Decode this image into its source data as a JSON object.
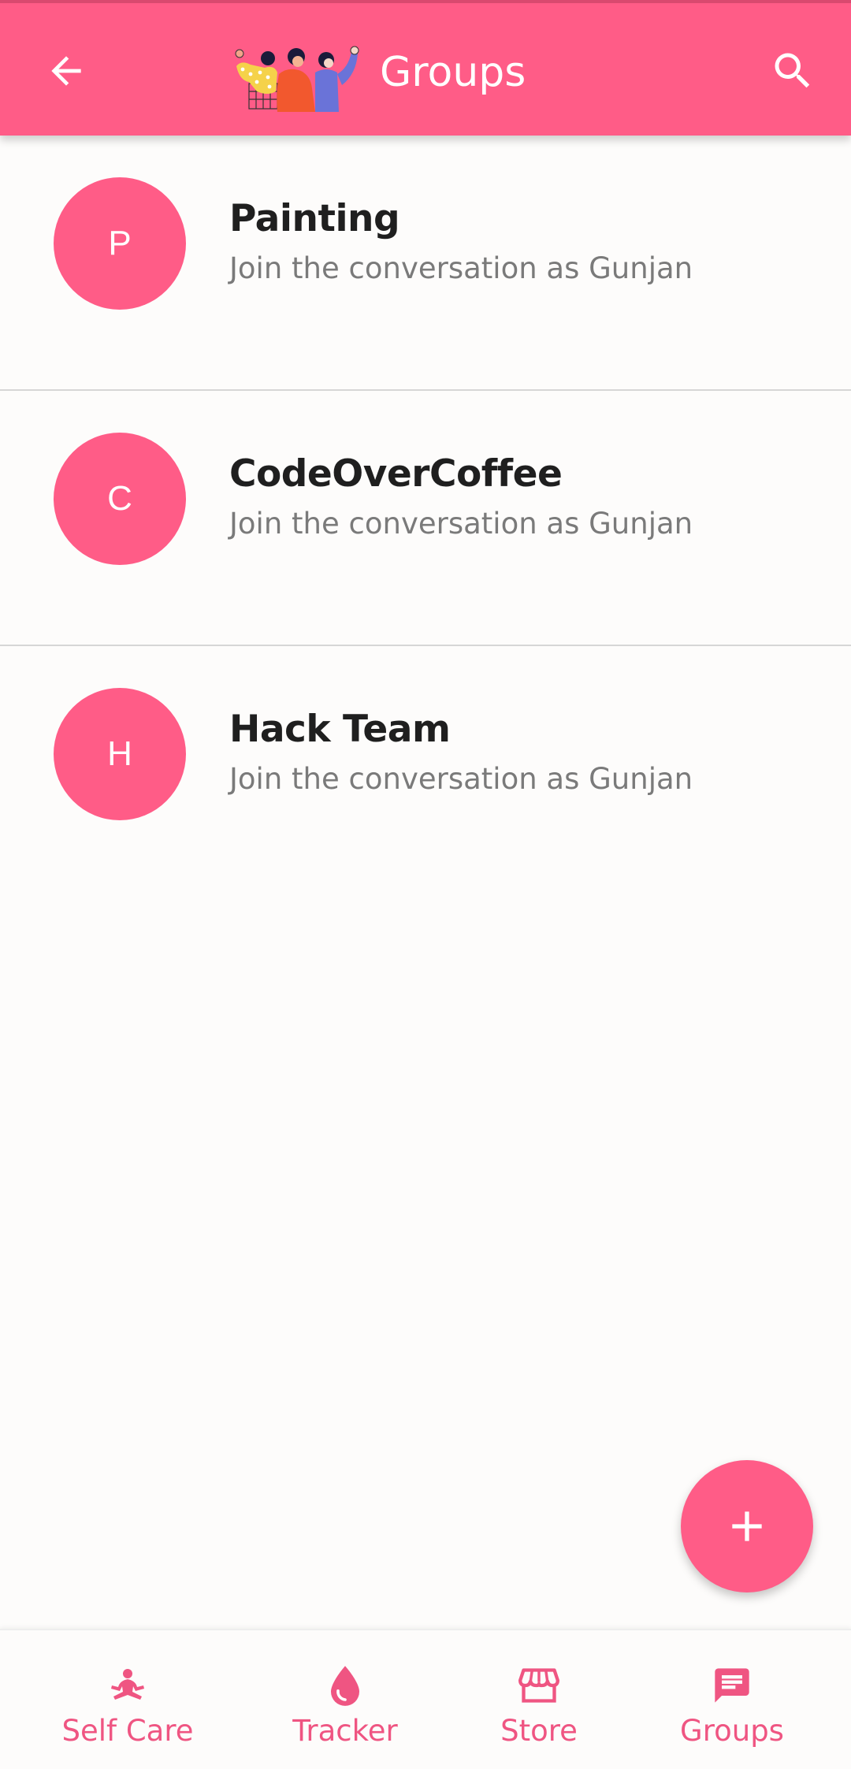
{
  "appbar": {
    "title": "Groups",
    "back_icon": "arrow-left-icon",
    "search_icon": "search-icon",
    "logo": "women-group-illustration"
  },
  "groups": [
    {
      "initial": "P",
      "name": "Painting",
      "subtitle": "Join the conversation as Gunjan"
    },
    {
      "initial": "C",
      "name": "CodeOverCoffee",
      "subtitle": "Join the conversation as Gunjan"
    },
    {
      "initial": "H",
      "name": "Hack Team",
      "subtitle": "Join the conversation as Gunjan"
    }
  ],
  "fab": {
    "icon": "plus-icon"
  },
  "bottom_nav": [
    {
      "label": "Self Care",
      "icon": "meditation-icon"
    },
    {
      "label": "Tracker",
      "icon": "drop-icon"
    },
    {
      "label": "Store",
      "icon": "store-icon"
    },
    {
      "label": "Groups",
      "icon": "chat-icon"
    }
  ],
  "colors": {
    "primary": "#ff5c87",
    "nav_label": "#ef5582",
    "title_text": "#1f1f1f",
    "subtitle_text": "#7a7a7a",
    "background": "#fdfcfb"
  }
}
